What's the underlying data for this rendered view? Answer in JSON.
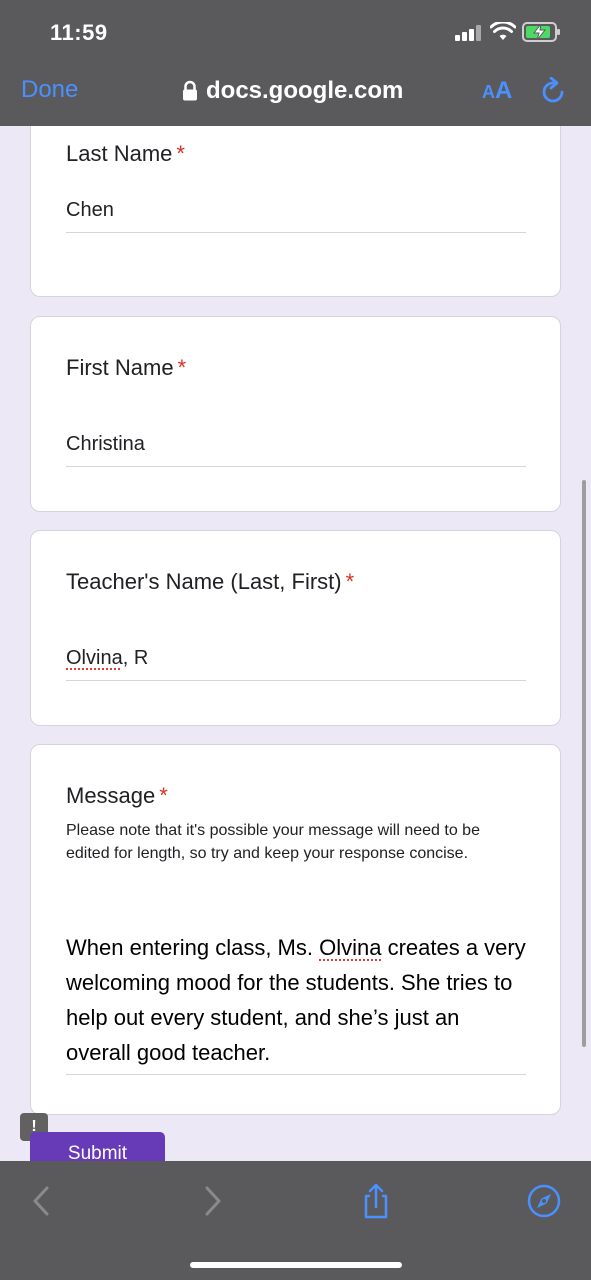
{
  "status": {
    "time": "11:59"
  },
  "browser": {
    "done_label": "Done",
    "url": "docs.google.com",
    "text_size_small": "A",
    "text_size_large": "A"
  },
  "form": {
    "required_marker": "*",
    "fields": [
      {
        "label": "Last Name",
        "value": "Chen"
      },
      {
        "label": "First Name",
        "value": "Christina"
      },
      {
        "label": "Teacher's Name (Last, First)",
        "value_misspelled": "Olvina",
        "value_rest": ", R"
      },
      {
        "label": "Message",
        "helper": "Please note that it's possible your message will need to be edited for length, so try and keep your response concise.",
        "value_part1": "When entering class, Ms. ",
        "value_misspelled": "Olvina",
        "value_part2": " creates a very welcoming mood for the students. She tries to help out every student, and she’s just an overall good teacher."
      }
    ],
    "report_icon_text": "!",
    "submit_label": "Submit"
  },
  "colors": {
    "accent": "#673ab7",
    "safari_blue": "#4a90ff",
    "required": "#d93025",
    "chrome_bg": "#5a5a5c",
    "page_bg": "#ece8f5"
  },
  "icons": [
    "lock-icon",
    "reload-icon",
    "back-icon",
    "forward-icon",
    "share-icon",
    "compass-icon",
    "signal-icon",
    "wifi-icon",
    "battery-charging-icon",
    "report-icon"
  ]
}
